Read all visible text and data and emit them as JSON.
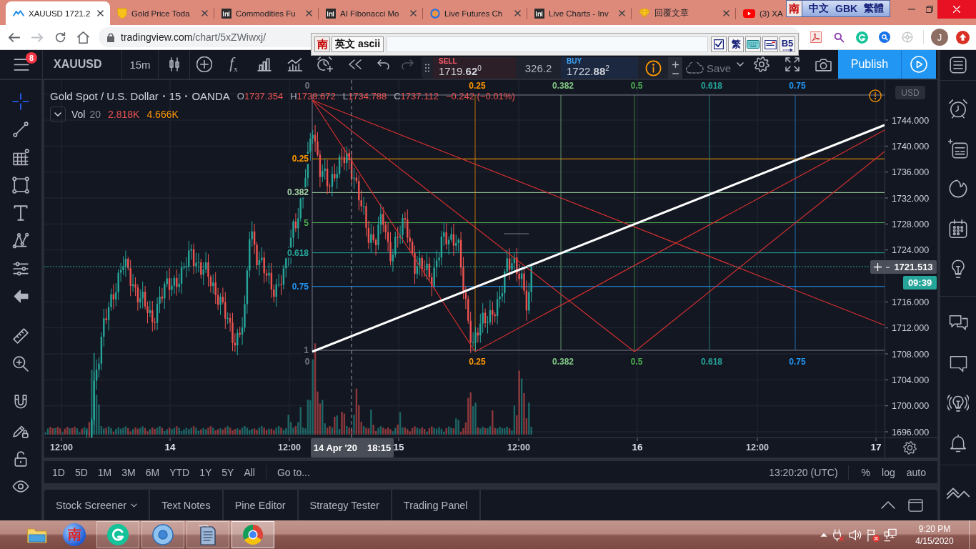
{
  "browser": {
    "tabs": [
      {
        "title": "XAUUSD 1721.2",
        "selected": true,
        "kind": "chart"
      },
      {
        "title": "Gold Price Toda",
        "selected": false,
        "kind": "shield"
      },
      {
        "title": "Commodities Fu",
        "selected": false,
        "kind": "square"
      },
      {
        "title": "AI Fibonacci Mo",
        "selected": false,
        "kind": "square"
      },
      {
        "title": "Live Futures Ch",
        "selected": false,
        "kind": "ring"
      },
      {
        "title": "Live Charts - Inv",
        "selected": false,
        "kind": "square"
      },
      {
        "title": "回覆文章",
        "selected": false,
        "kind": "gem"
      },
      {
        "title": "(3) XA",
        "selected": false,
        "kind": "video"
      }
    ],
    "address": {
      "host": "tradingview.com",
      "path": "/chart/5xZWiwxj/"
    },
    "profile_initial": "J"
  },
  "ime_status": {
    "logo": "南",
    "items": [
      "中文",
      "GBK",
      "繁體"
    ]
  },
  "ime_bar": {
    "logo": "南",
    "mode": "英文 ascii",
    "tools": [
      {
        "kind": "checkbox",
        "checked": true
      },
      {
        "kind": "char",
        "label": "繁"
      },
      {
        "kind": "keyboard"
      },
      {
        "kind": "card"
      },
      {
        "kind": "code",
        "label": "B5"
      }
    ]
  },
  "header": {
    "menu_badge": "8",
    "symbol": "XAUUSD",
    "interval": "15m",
    "indicators": "f$_{x}$",
    "sell": {
      "label": "SELL",
      "price": "1719.**62**$^{0}$"
    },
    "spread": "326.2",
    "buy": {
      "label": "BUY",
      "price": "1722.**88**$^{2}$"
    },
    "save": "Save",
    "publish": "Publish"
  },
  "drawing_tools": [
    {
      "selected": true
    },
    {
      "selected": false
    },
    {
      "selected": false
    },
    {
      "selected": false
    },
    {
      "selected": false
    },
    {
      "selected": false
    },
    {
      "selected": false
    },
    {
      "selected": false
    },
    {
      "selected": false
    },
    {
      "selected": false
    },
    {
      "selected": false
    },
    {
      "selected": false
    },
    {
      "selected": false
    },
    {
      "selected": false
    }
  ],
  "legend": {
    "title": "Gold Spot / U.S. Dollar",
    "interval": "15",
    "source": "OANDA",
    "ohlc": [
      {
        "key": "O",
        "value": "1737.354"
      },
      {
        "key": "H",
        "value": "1738.672"
      },
      {
        "key": "L",
        "value": "1734.788"
      },
      {
        "key": "C",
        "value": "1737.112"
      }
    ],
    "change": "−0.242 (−0.01%)",
    "volume": {
      "name": "Vol",
      "length": "20",
      "values": [
        {
          "text": "2.818K",
          "color": "#ef5350"
        },
        {
          "text": "4.666K",
          "color": "#ff9800"
        }
      ]
    }
  },
  "chart": {
    "fib_levels": [
      {
        "label": "0.25",
        "color": "#ff9800"
      },
      {
        "label": "0.382",
        "color": "#a5d6a7"
      },
      {
        "label": "5",
        "color": "#4caf50"
      },
      {
        "label": "0.618",
        "color": "#26a69a"
      },
      {
        "label": "0.75",
        "color": "#2196f3"
      },
      {
        "label": "1",
        "color": "#787b86"
      }
    ],
    "fib_time_top": [
      {
        "label": "0",
        "color": "#787b86"
      },
      {
        "label": "0.25",
        "color": "#ff9800"
      },
      {
        "label": "0.382",
        "color": "#81c784"
      },
      {
        "label": "0.5",
        "color": "#4caf50"
      },
      {
        "label": "0.618",
        "color": "#26a69a"
      },
      {
        "label": "0.75",
        "color": "#2196f3"
      }
    ],
    "fib_time_bottom": [
      {
        "label": "0",
        "color": "#787b86"
      },
      {
        "label": "0.25",
        "color": "#ff9800"
      },
      {
        "label": "0.382",
        "color": "#81c784"
      },
      {
        "label": "0.5",
        "color": "#4caf50"
      },
      {
        "label": "0.618",
        "color": "#26a69a"
      },
      {
        "label": "0.75",
        "color": "#2196f3"
      }
    ],
    "price_axis": {
      "currency": "USD",
      "labels": [
        "1744.000",
        "1740.000",
        "1736.000",
        "1732.000",
        "1728.000",
        "1724.000",
        "1716.000",
        "1712.000",
        "1708.000",
        "1704.000",
        "1700.000",
        "1696.000"
      ]
    },
    "crosshair": {
      "price": "1721.513",
      "date": "14 Apr '20",
      "time": "18:15"
    },
    "countdown": "09:39",
    "time_axis": [
      {
        "text": "12:00",
        "kind": "time"
      },
      {
        "text": "14",
        "kind": "day"
      },
      {
        "text": "12:00",
        "kind": "time"
      },
      {
        "text": "15",
        "kind": "day"
      },
      {
        "text": "12:00",
        "kind": "time"
      },
      {
        "text": "16",
        "kind": "day"
      },
      {
        "text": "12:00",
        "kind": "time"
      },
      {
        "text": "17",
        "kind": "day"
      }
    ]
  },
  "range_bar": {
    "ranges": [
      "1D",
      "5D",
      "1M",
      "3M",
      "6M",
      "YTD",
      "1Y",
      "5Y",
      "All"
    ],
    "goto": "Go to...",
    "clock": "13:20:20 (UTC)",
    "scales": [
      "%",
      "log",
      "auto"
    ]
  },
  "panel_tabs": [
    {
      "label": "Stock Screener",
      "dropdown": true
    },
    {
      "label": "Text Notes",
      "dropdown": false
    },
    {
      "label": "Pine Editor",
      "dropdown": false
    },
    {
      "label": "Strategy Tester",
      "dropdown": false
    },
    {
      "label": "Trading Panel",
      "dropdown": false
    }
  ],
  "taskbar": {
    "ime_label": "南",
    "time": "9:20 PM",
    "date": "4/15/2020"
  }
}
